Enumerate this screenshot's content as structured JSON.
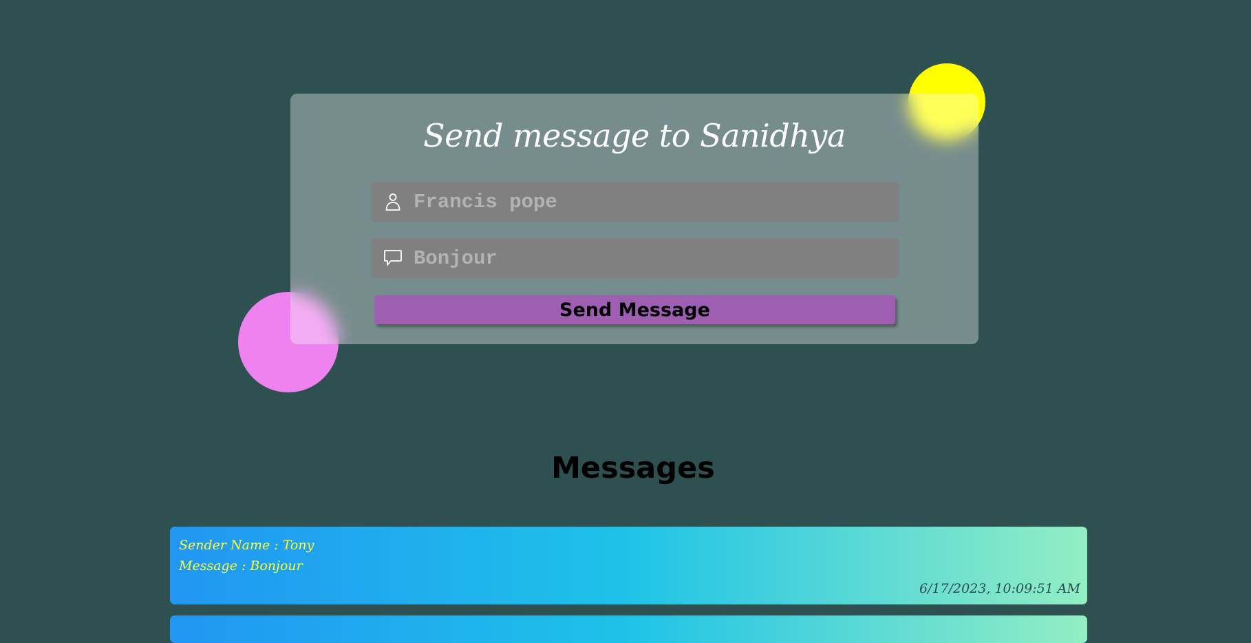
{
  "form": {
    "title": "Send message to Sanidhya",
    "name_field": {
      "placeholder": "Francis pope",
      "icon": "user-icon"
    },
    "message_field": {
      "placeholder": "Bonjour",
      "icon": "speech-bubble-icon"
    },
    "send_label": "Send Message"
  },
  "messages": {
    "heading": "Messages",
    "items": [
      {
        "sender": "Sender Name : Tony",
        "text": "Message : Bonjour",
        "timestamp": "6/17/2023, 10:09:51 AM"
      }
    ]
  },
  "colors": {
    "background": "#2f5050",
    "accent_yellow": "#ffff00",
    "accent_pink": "#ee82ee",
    "button": "#9e5fb3",
    "message_text": "#ffff33"
  }
}
